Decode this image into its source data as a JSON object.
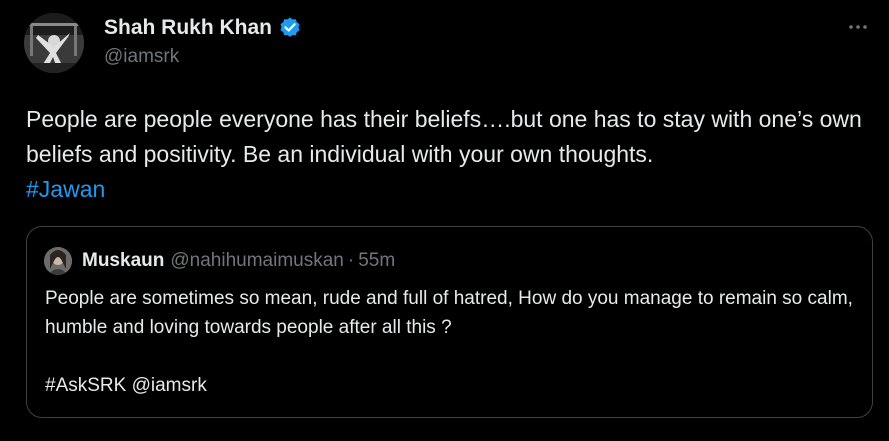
{
  "tweet": {
    "author": {
      "name": "Shah Rukh Khan",
      "handle": "@iamsrk",
      "avatar_icon": "profile-photo",
      "verified_icon": "verified-badge-icon",
      "verified_color": "#1d9bf0"
    },
    "more_icon": "more-horizontal-icon",
    "text_before_hashtag": "People are people everyone has their beliefs….but one has to stay with one’s own beliefs and positivity. Be an individual with your own thoughts.",
    "hashtag": "#Jawan",
    "link_color": "#1d9bf0"
  },
  "quote": {
    "name": "Muskaun",
    "handle": "@nahihumaimuskan",
    "separator": "·",
    "time": "55m",
    "text": "People are sometimes so mean, rude and full of hatred, How do you manage to remain so calm, humble and loving towards people after all this ?\n\n#AskSRK @iamsrk"
  }
}
